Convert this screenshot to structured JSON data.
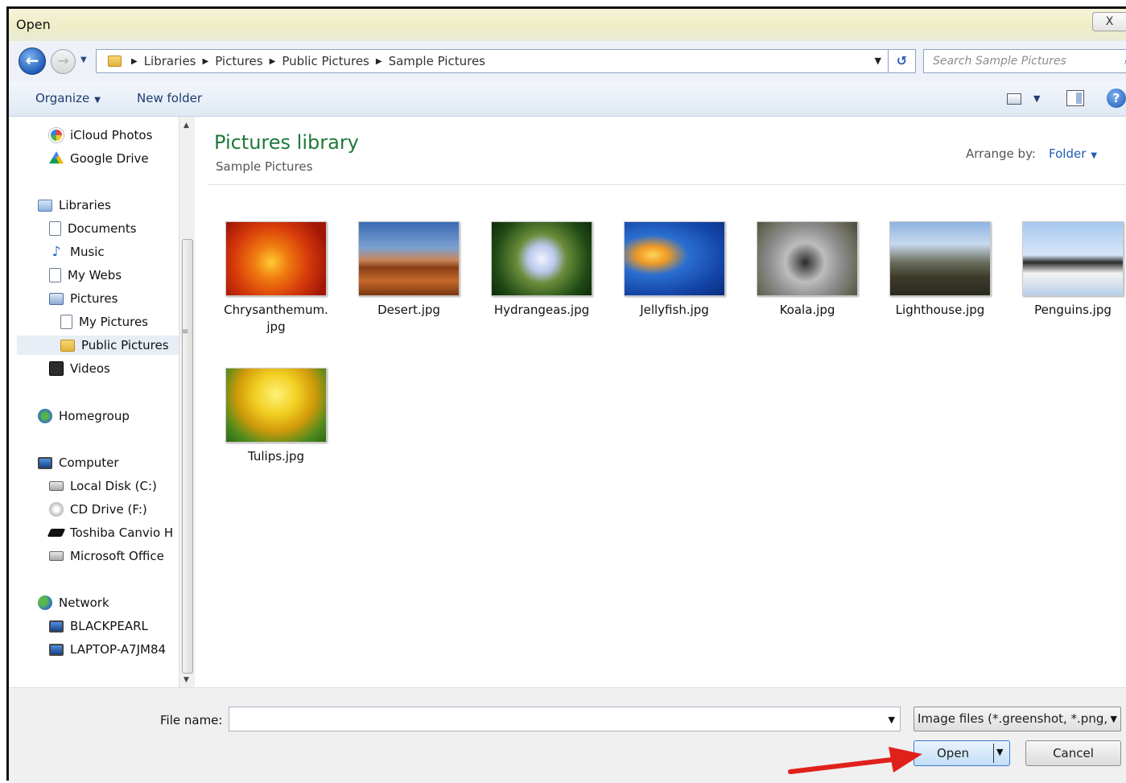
{
  "window": {
    "title": "Open",
    "close_symbol": "X"
  },
  "nav": {
    "back_symbol": "←",
    "forward_symbol": "→",
    "breadcrumbs": [
      "Libraries",
      "Pictures",
      "Public Pictures",
      "Sample Pictures"
    ],
    "search_placeholder": "Search Sample Pictures"
  },
  "toolbar": {
    "organize_label": "Organize",
    "new_folder_label": "New folder",
    "help_symbol": "?"
  },
  "navpane": {
    "items": [
      {
        "label": "iCloud Photos",
        "icon": "icloud-photos-icon"
      },
      {
        "label": "Google Drive",
        "icon": "google-drive-icon"
      },
      {
        "label": "Libraries",
        "icon": "libraries-icon"
      },
      {
        "label": "Documents",
        "icon": "documents-icon"
      },
      {
        "label": "Music",
        "icon": "music-icon"
      },
      {
        "label": "My Webs",
        "icon": "document-icon"
      },
      {
        "label": "Pictures",
        "icon": "pictures-icon"
      },
      {
        "label": "My Pictures",
        "icon": "document-icon"
      },
      {
        "label": "Public Pictures",
        "icon": "folder-icon"
      },
      {
        "label": "Videos",
        "icon": "videos-icon"
      },
      {
        "label": "Homegroup",
        "icon": "homegroup-icon"
      },
      {
        "label": "Computer",
        "icon": "computer-icon"
      },
      {
        "label": "Local Disk (C:)",
        "icon": "local-disk-icon"
      },
      {
        "label": "CD Drive (F:)",
        "icon": "cd-drive-icon"
      },
      {
        "label": "Toshiba Canvio H",
        "icon": "external-drive-icon"
      },
      {
        "label": "Microsoft Office",
        "icon": "drive-icon"
      },
      {
        "label": "Network",
        "icon": "network-icon"
      },
      {
        "label": "BLACKPEARL",
        "icon": "computer-icon"
      },
      {
        "label": "LAPTOP-A7JM84",
        "icon": "computer-icon"
      }
    ],
    "selected": "Public Pictures"
  },
  "content": {
    "library_title": "Pictures library",
    "library_subtitle": "Sample Pictures",
    "arrange_label": "Arrange by:",
    "arrange_value": "Folder",
    "files": [
      {
        "name_line1": "Chrysanthemum.",
        "name_line2": "jpg"
      },
      {
        "name_line1": "Desert.jpg"
      },
      {
        "name_line1": "Hydrangeas.jpg"
      },
      {
        "name_line1": "Jellyfish.jpg"
      },
      {
        "name_line1": "Koala.jpg"
      },
      {
        "name_line1": "Lighthouse.jpg"
      },
      {
        "name_line1": "Penguins.jpg"
      },
      {
        "name_line1": "Tulips.jpg"
      }
    ]
  },
  "footer": {
    "file_name_label": "File name:",
    "file_name_value": "",
    "file_type_value": "Image files (*.greenshot, *.png,",
    "open_label": "Open",
    "cancel_label": "Cancel"
  },
  "colors": {
    "accent": "#1f5bb6",
    "library_title": "#1e7a3a",
    "annotation_arrow": "#e0201b"
  }
}
